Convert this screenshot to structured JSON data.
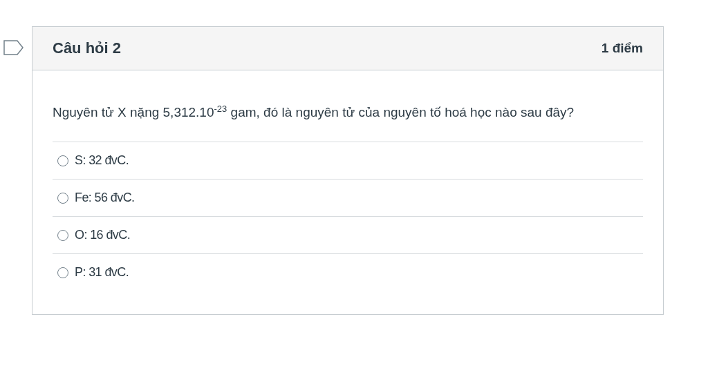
{
  "question": {
    "title": "Câu hỏi 2",
    "points": "1 điểm",
    "flagged": false,
    "text": "Nguyên tử X nặng 5,312.10$^{-23}$ gam, đó là nguyên tử của nguyên tố hoá học nào sau đây?",
    "answers": [
      {
        "label": "S: 32 đvC.",
        "selected": false
      },
      {
        "label": "Fe: 56 đvC.",
        "selected": false
      },
      {
        "label": "O: 16 đvC.",
        "selected": false
      },
      {
        "label": "P: 31 đvC.",
        "selected": false
      }
    ]
  }
}
